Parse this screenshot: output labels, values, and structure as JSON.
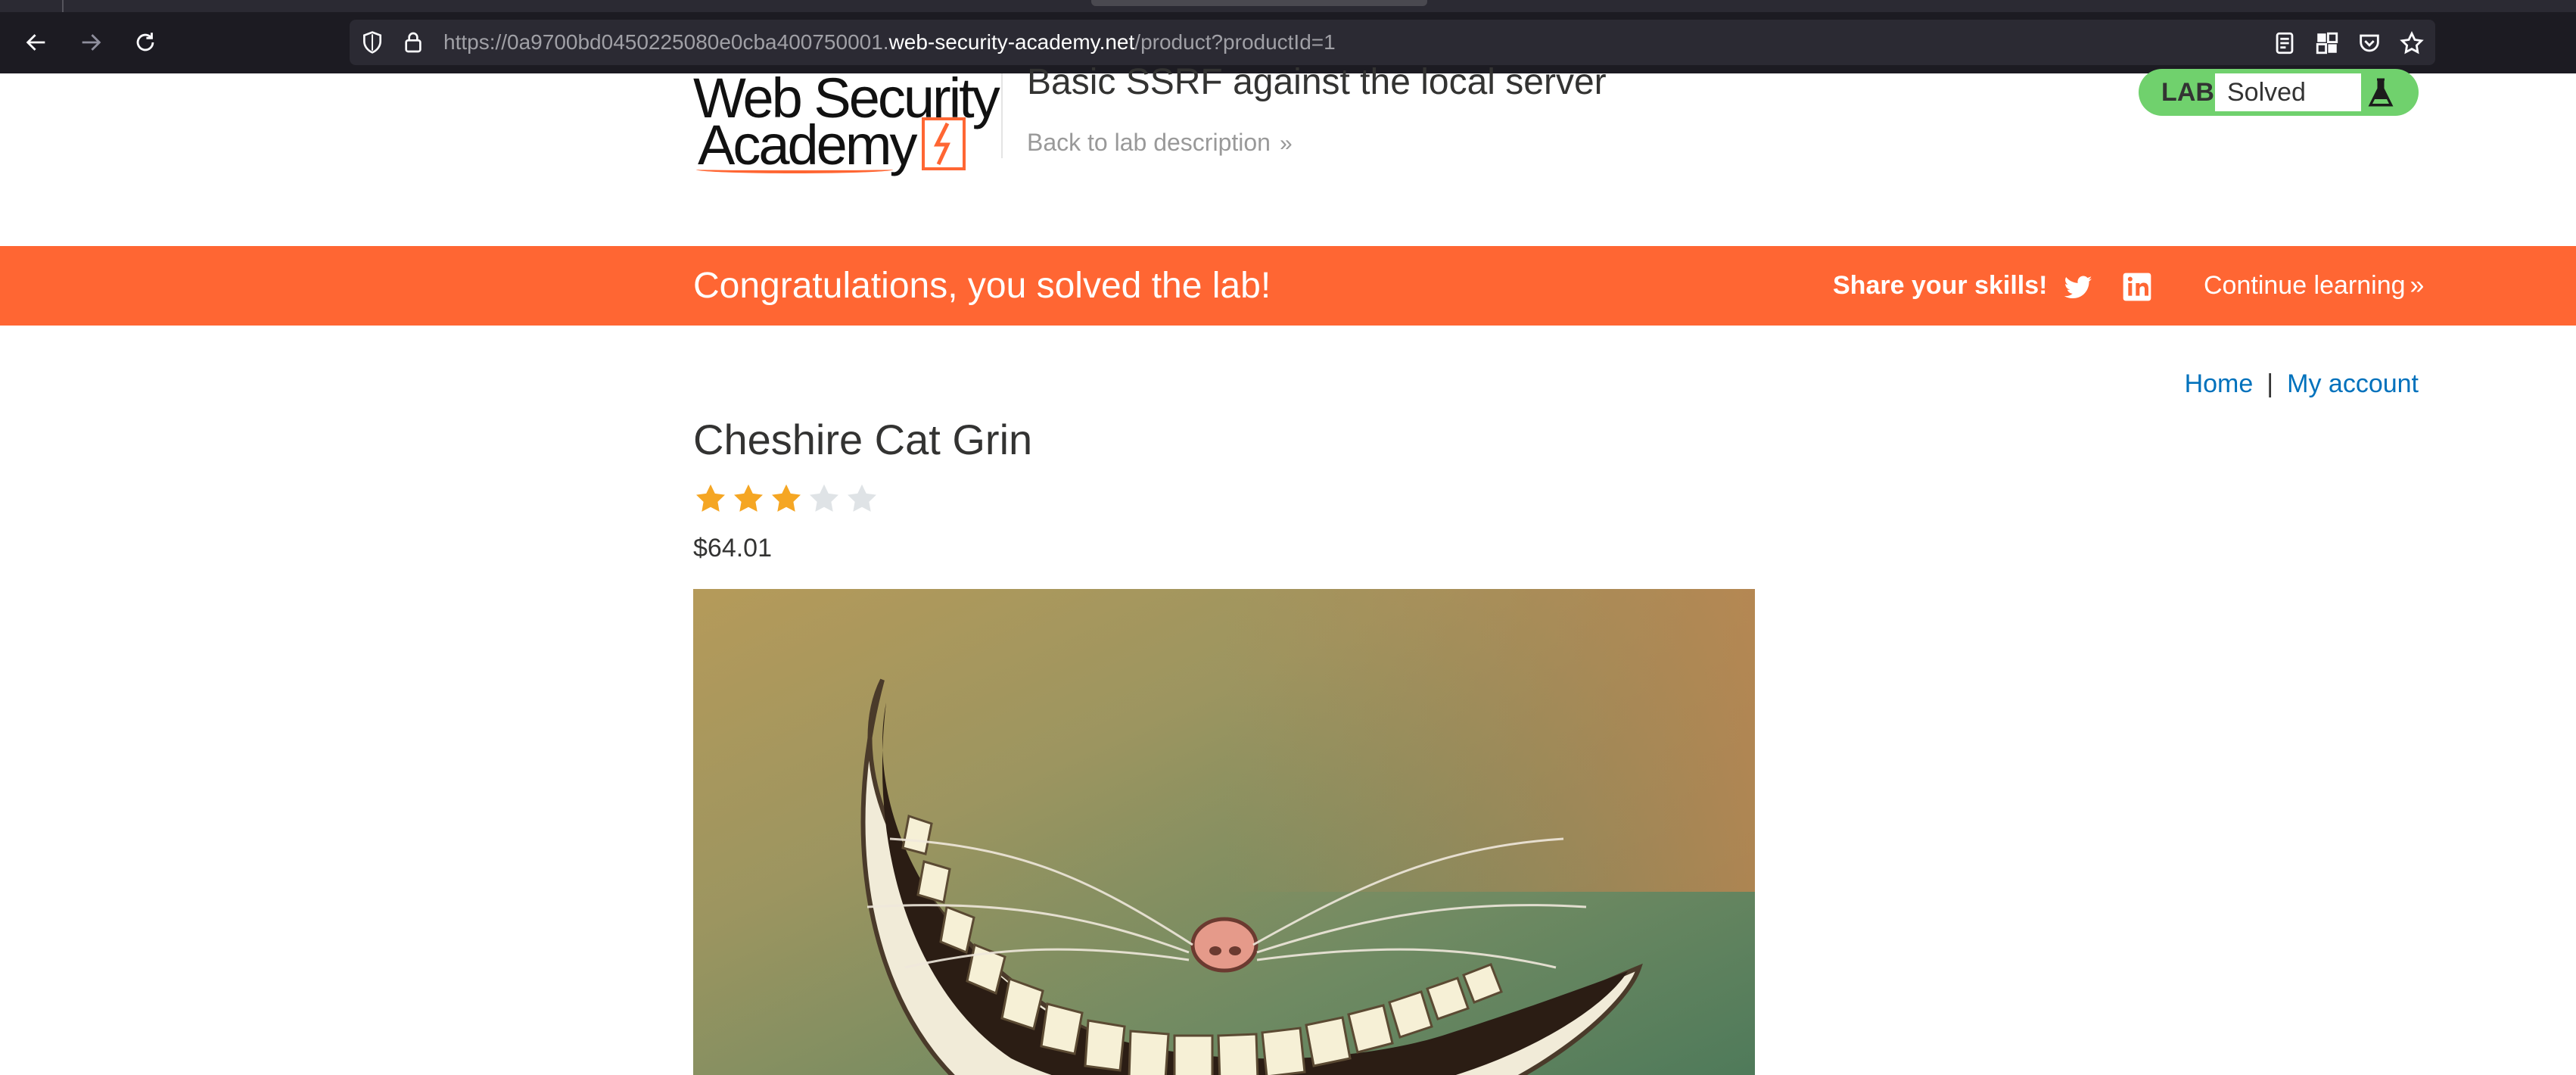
{
  "browser": {
    "url_prefix": "https://0a9700bd0450225080e0cba400750001.",
    "url_host": "web-security-academy.net",
    "url_path": "/product?productId=1"
  },
  "header": {
    "logo_line1": "Web Security",
    "logo_line2": "Academy",
    "lab_title": "Basic SSRF against the local server",
    "back_link": "Back to lab description",
    "lab_badge": "LAB",
    "lab_status": "Solved"
  },
  "banner": {
    "message": "Congratulations, you solved the lab!",
    "share_label": "Share your skills!",
    "continue_label": "Continue learning"
  },
  "nav": {
    "home": "Home",
    "separator": "|",
    "my_account": "My account"
  },
  "product": {
    "title": "Cheshire Cat Grin",
    "rating": 3,
    "rating_max": 5,
    "price": "$64.01"
  },
  "colors": {
    "brand_orange": "#ff6633",
    "lab_green": "#70d16d",
    "link_blue": "#0071bc",
    "star_filled": "#f5a623",
    "star_empty": "#dfe3e6"
  }
}
